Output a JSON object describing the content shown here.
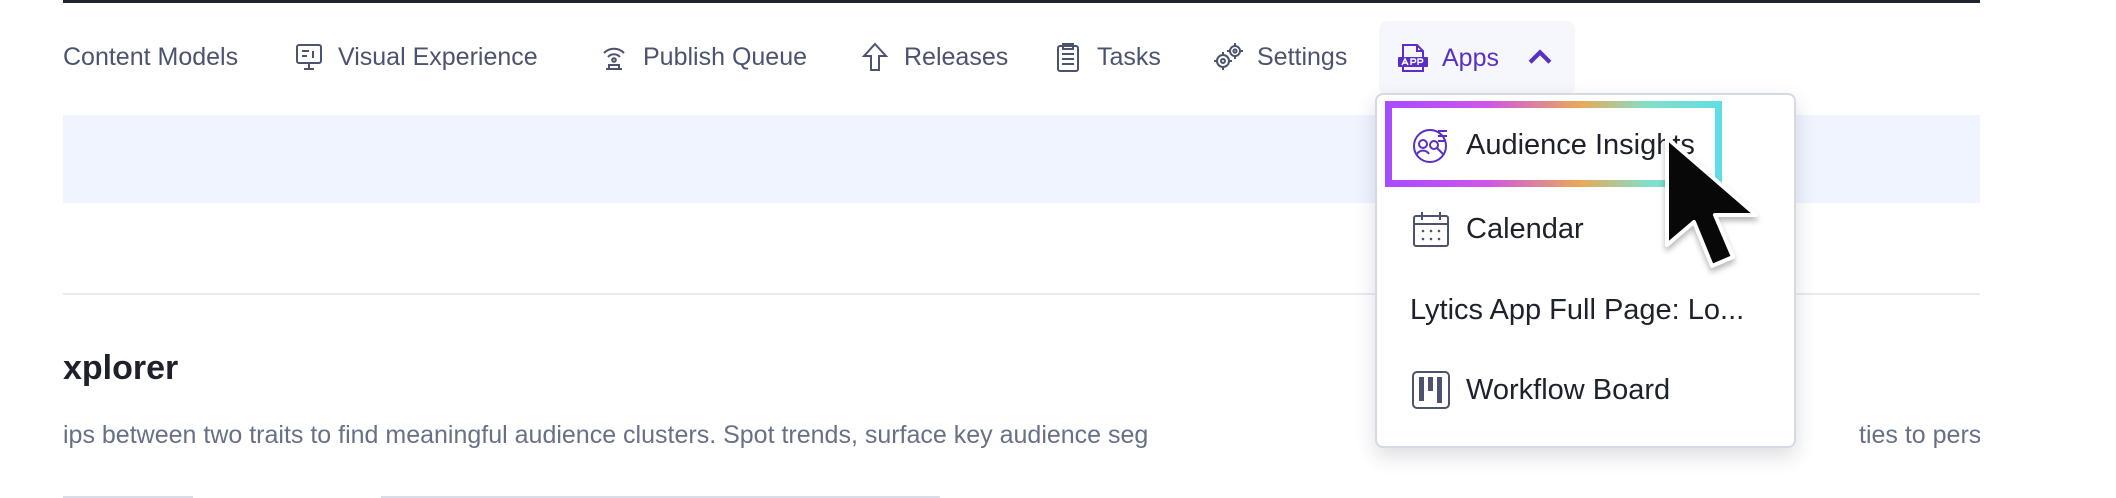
{
  "navbar": {
    "items": [
      {
        "label": "Content Models",
        "icon": ""
      },
      {
        "label": "Visual Experience",
        "icon": "visual-experience-icon"
      },
      {
        "label": "Publish Queue",
        "icon": "publish-queue-icon"
      },
      {
        "label": "Releases",
        "icon": "releases-icon"
      },
      {
        "label": "Tasks",
        "icon": "tasks-icon"
      },
      {
        "label": "Settings",
        "icon": "settings-icon"
      }
    ],
    "apps": {
      "label": "Apps",
      "icon": "apps-icon",
      "state_icon": "chevron-up-icon"
    }
  },
  "page": {
    "title": "xplorer",
    "description": "ips between two traits to find meaningful audience clusters. Spot trends, surface key audience seg",
    "description_tail": "ties to persona"
  },
  "apps_menu": {
    "items": [
      {
        "label": "Audience Insights",
        "icon": "audience-insights-icon",
        "selected": true
      },
      {
        "label": "Calendar",
        "icon": "calendar-icon"
      },
      {
        "label": "Lytics App Full Page: Lo...",
        "icon": ""
      },
      {
        "label": "Workflow Board",
        "icon": "workflow-board-icon"
      }
    ]
  },
  "colors": {
    "nav_text": "#4b5370",
    "apps_accent": "#5a2fc5",
    "highlight_band": "#f0f4fe",
    "menu_text": "#1d212b",
    "focus_gradient": [
      "#a64bff",
      "#cf55ea",
      "#e9a957",
      "#83dfc8",
      "#5fdde7"
    ]
  },
  "cursor": {
    "icon": "mouse-pointer-icon"
  }
}
